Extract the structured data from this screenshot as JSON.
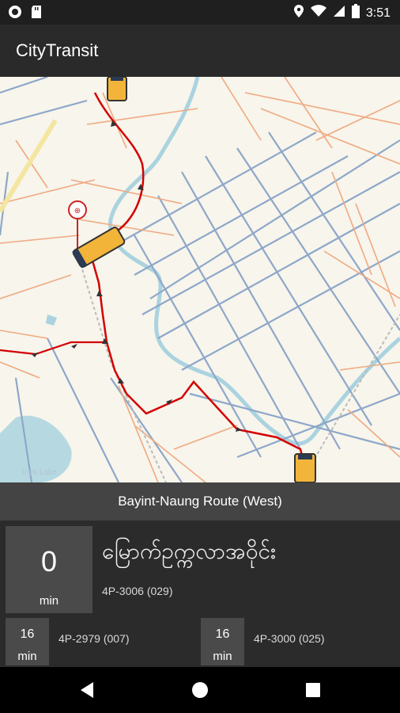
{
  "status_bar": {
    "time": "3:51"
  },
  "app": {
    "title": "CityTransit"
  },
  "map": {
    "watermark": "Inya Lake"
  },
  "route": {
    "name": "Bayint-Naung Route (West)"
  },
  "next_arrival": {
    "minutes": "0",
    "unit": "min",
    "stop_name": "မြောက်ဥက္ကလာအဝိုင်း",
    "plate": "4P-3006 (029)"
  },
  "upcoming": [
    {
      "minutes": "16",
      "unit": "min",
      "plate": "4P-2979 (007)"
    },
    {
      "minutes": "16",
      "unit": "min",
      "plate": "4P-3000 (025)"
    }
  ],
  "colors": {
    "route": "#d40000",
    "bus": "#f2b53a",
    "roads_major": "#8ea7c9",
    "roads_minor": "#f0a980",
    "water": "#aad3df"
  }
}
